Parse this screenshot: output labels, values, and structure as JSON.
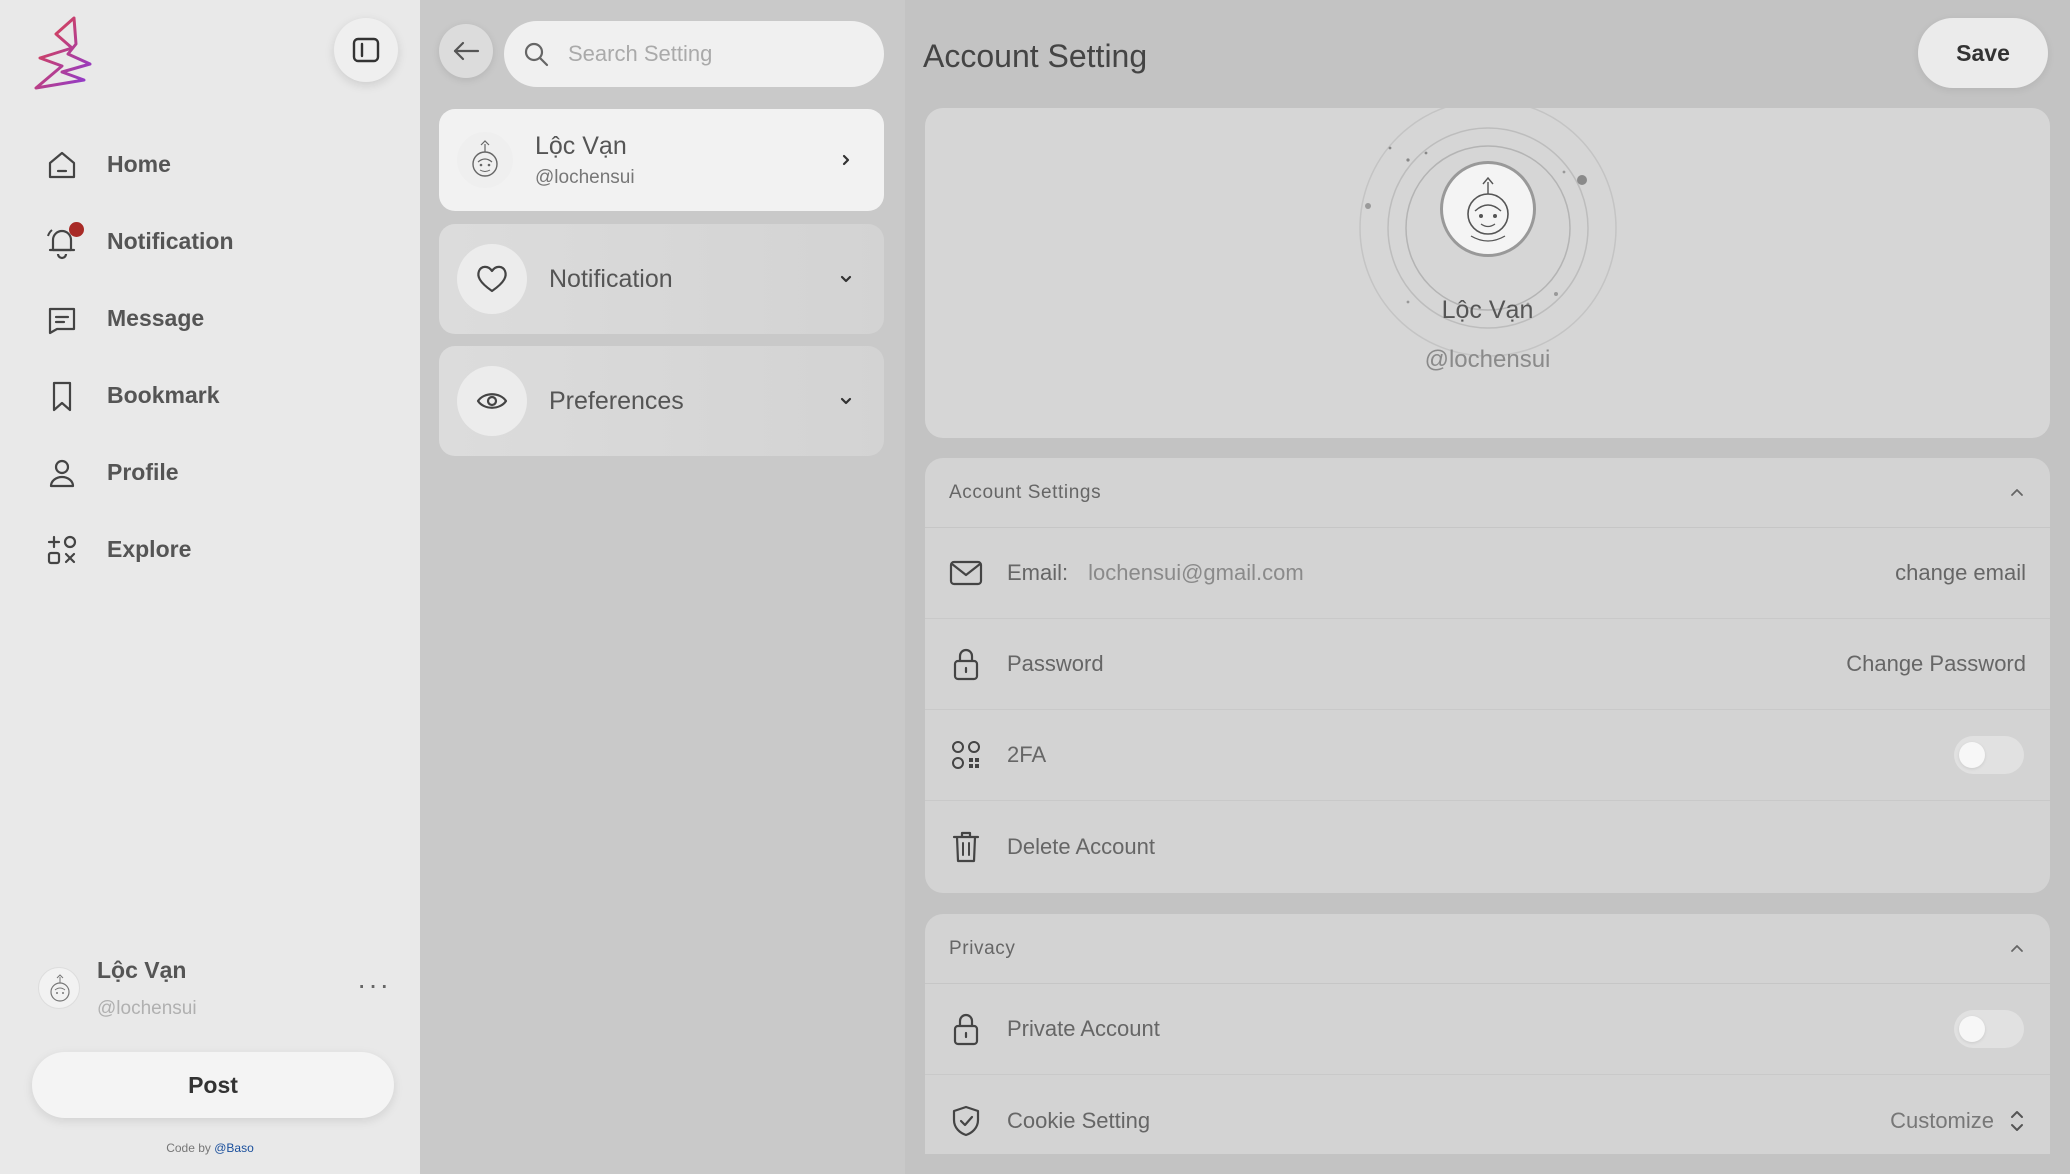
{
  "sidebar": {
    "nav": [
      {
        "label": "Home",
        "icon": "home-icon"
      },
      {
        "label": "Notification",
        "icon": "bell-icon",
        "has_badge": true
      },
      {
        "label": "Message",
        "icon": "message-icon"
      },
      {
        "label": "Bookmark",
        "icon": "bookmark-icon"
      },
      {
        "label": "Profile",
        "icon": "user-icon"
      },
      {
        "label": "Explore",
        "icon": "explore-icon"
      }
    ],
    "user": {
      "name": "Lộc Vạn",
      "handle": "@lochensui"
    },
    "more_label": "···",
    "post_label": "Post",
    "credit_prefix": "Code by ",
    "credit_author": "@Baso"
  },
  "settings_nav": {
    "search": {
      "placeholder": "Search Setting",
      "value": ""
    },
    "profile": {
      "name": "Lộc Vạn",
      "handle": "@lochensui"
    },
    "items": [
      {
        "label": "Notification",
        "icon": "heart-icon"
      },
      {
        "label": "Preferences",
        "icon": "eye-icon"
      }
    ]
  },
  "main": {
    "title": "Account Setting",
    "save_label": "Save",
    "profile": {
      "name": "Lộc Vạn",
      "handle": "@lochensui"
    },
    "account_section": {
      "title": "Account Settings",
      "email_label": "Email:",
      "email_value": "lochensui@gmail.com",
      "email_action": "change email",
      "password_label": "Password",
      "password_action": "Change Password",
      "twofa_label": "2FA",
      "twofa_enabled": false,
      "delete_label": "Delete Account"
    },
    "privacy_section": {
      "title": "Privacy",
      "private_label": "Private Account",
      "private_enabled": false,
      "cookie_label": "Cookie Setting",
      "cookie_action": "Customize"
    }
  },
  "colors": {
    "notification_badge": "#a82a26",
    "logo_red": "#e8443a",
    "logo_purple": "#8a3ad6",
    "credit_link": "#1a4f9c"
  }
}
